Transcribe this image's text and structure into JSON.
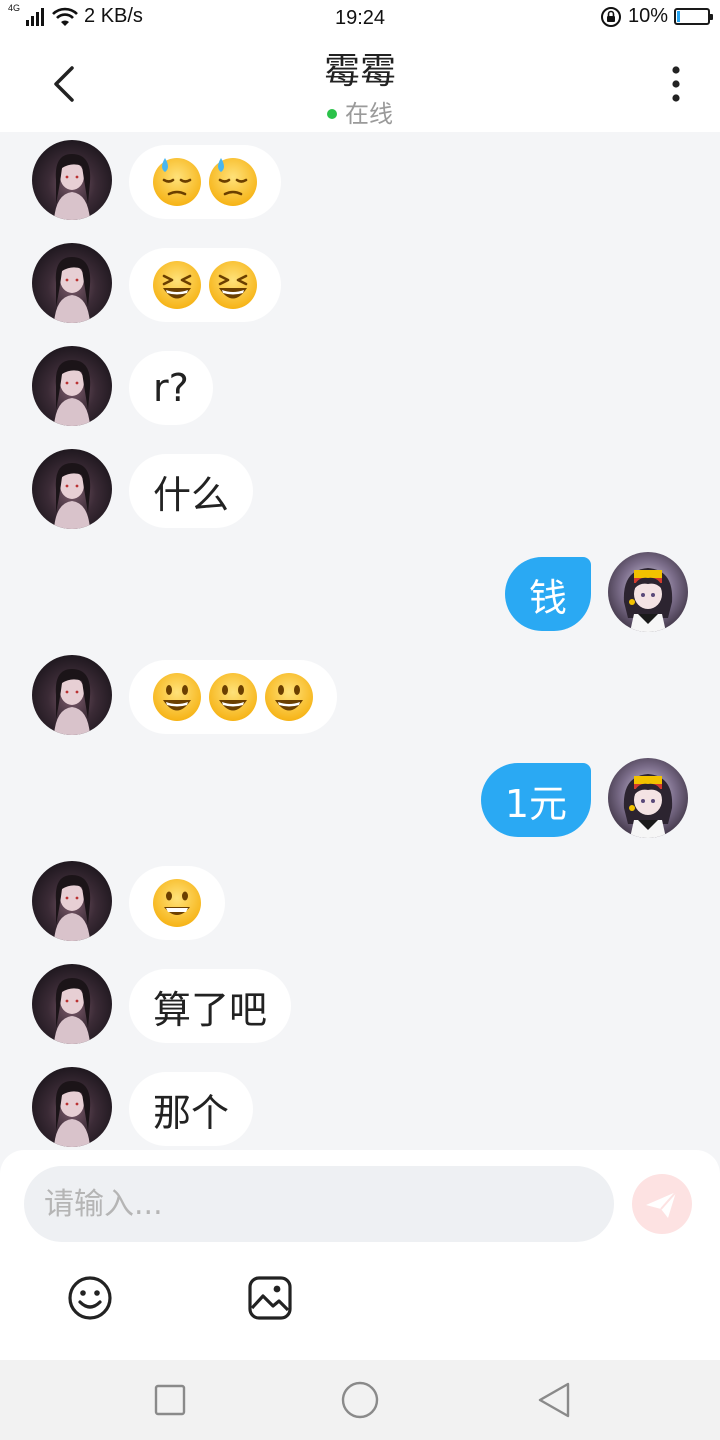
{
  "status_bar": {
    "network": "4G",
    "speed": "2 KB/s",
    "time": "19:24",
    "battery": "10%",
    "battery_level": 0.1
  },
  "header": {
    "title": "霉霉",
    "status": "在线",
    "status_color": "#2bc24a"
  },
  "messages": [
    {
      "from": "them",
      "emojis": [
        "sweat-emoji",
        "sweat-emoji"
      ]
    },
    {
      "from": "them",
      "emojis": [
        "laugh-emoji",
        "laugh-emoji"
      ]
    },
    {
      "from": "them",
      "text": "r?"
    },
    {
      "from": "them",
      "text": "什么"
    },
    {
      "from": "me",
      "text": "钱"
    },
    {
      "from": "them",
      "emojis": [
        "smiley-emoji",
        "smiley-emoji",
        "smiley-emoji"
      ]
    },
    {
      "from": "me",
      "text": "1元"
    },
    {
      "from": "them",
      "emojis": [
        "grin-emoji"
      ]
    },
    {
      "from": "them",
      "text": "算了吧"
    },
    {
      "from": "them",
      "text": "那个"
    }
  ],
  "composer": {
    "placeholder": "请输入..."
  },
  "colors": {
    "my_bubble": "#2aa9f3",
    "their_bubble": "#ffffff",
    "chat_background": "#f4f5f7"
  }
}
